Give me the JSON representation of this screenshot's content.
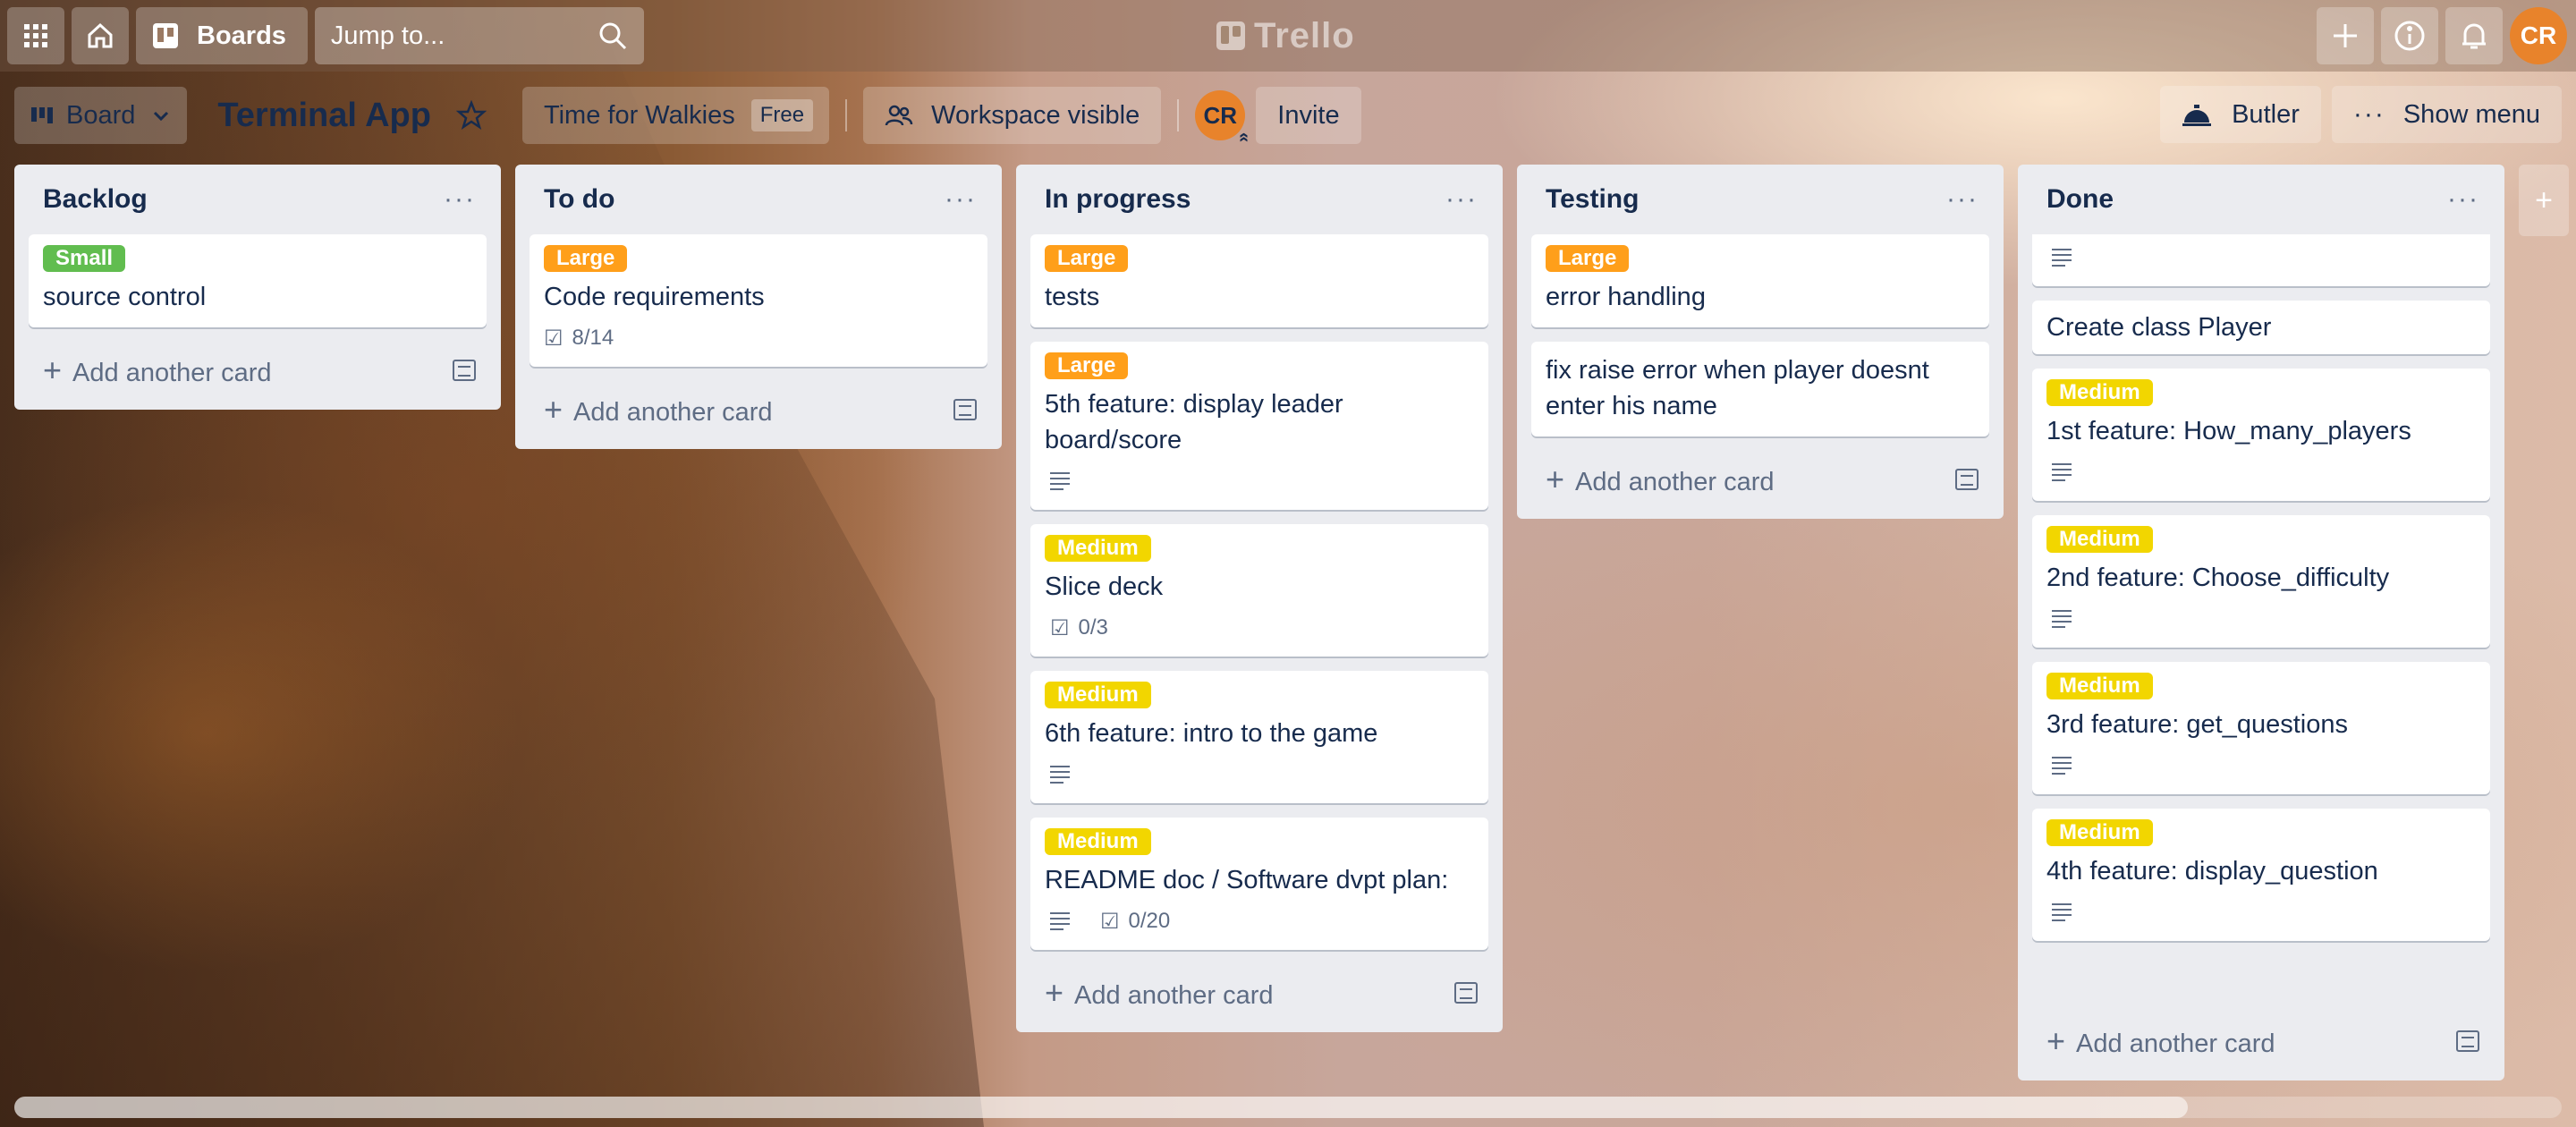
{
  "topbar": {
    "boards_label": "Boards",
    "search_placeholder": "Jump to...",
    "logo_text": "Trello",
    "user_initials": "CR"
  },
  "board": {
    "view_label": "Board",
    "title": "Terminal App",
    "workspace_name": "Time for Walkies",
    "workspace_plan": "Free",
    "visibility_label": "Workspace visible",
    "member_initials": "CR",
    "invite_label": "Invite",
    "butler_label": "Butler",
    "show_menu_label": "Show menu"
  },
  "add_card_label": "Add another card",
  "colors": {
    "small": "#61bd4f",
    "large": "#ff9f1a",
    "medium": "#f2d600"
  },
  "lists": [
    {
      "title": "Backlog",
      "cards": [
        {
          "label": "Small",
          "title": "source control"
        }
      ]
    },
    {
      "title": "To do",
      "cards": [
        {
          "label": "Large",
          "title": "Code requirements",
          "checklist": "8/14"
        }
      ]
    },
    {
      "title": "In progress",
      "cards": [
        {
          "label": "Large",
          "title": "tests"
        },
        {
          "label": "Large",
          "title": "5th feature: display leader board/score"
        },
        {
          "label": "Medium",
          "title": "Slice deck",
          "checklist": "0/3"
        },
        {
          "label": "Medium",
          "title": "6th feature: intro to the game"
        },
        {
          "label": "Medium",
          "title": "README doc / Software dvpt plan:",
          "checklist": "0/20"
        }
      ]
    },
    {
      "title": "Testing",
      "cards": [
        {
          "label": "Large",
          "title": "error handling"
        },
        {
          "title": "fix raise error when player doesnt enter his name"
        }
      ]
    },
    {
      "title": "Done",
      "cards": [
        {
          "title": "Create class Player"
        },
        {
          "label": "Medium",
          "title": "1st feature: How_many_players"
        },
        {
          "label": "Medium",
          "title": "2nd feature: Choose_difficulty"
        },
        {
          "label": "Medium",
          "title": "3rd feature: get_questions"
        },
        {
          "label": "Medium",
          "title": "4th feature: display_question"
        }
      ]
    }
  ]
}
